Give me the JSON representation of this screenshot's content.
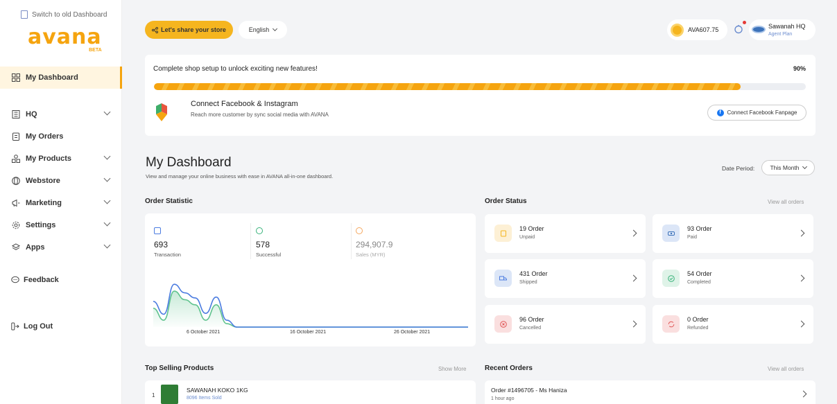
{
  "sidebar": {
    "switch_label": "Switch to old Dashboard",
    "logo": "avana",
    "logo_badge": "BETA",
    "items": [
      {
        "label": "My Dashboard",
        "icon": "grid-icon",
        "active": true
      },
      {
        "label": "HQ",
        "icon": "building-icon",
        "has_submenu": true
      },
      {
        "label": "My Orders",
        "icon": "clipboard-icon"
      },
      {
        "label": "My Products",
        "icon": "boxes-icon",
        "has_submenu": true
      },
      {
        "label": "Webstore",
        "icon": "globe-icon",
        "has_submenu": true
      },
      {
        "label": "Marketing",
        "icon": "megaphone-icon",
        "has_submenu": true
      },
      {
        "label": "Settings",
        "icon": "gear-icon",
        "has_submenu": true
      },
      {
        "label": "Apps",
        "icon": "layers-icon",
        "has_submenu": true
      }
    ],
    "feedback_label": "Feedback",
    "logout_label": "Log Out"
  },
  "topbar": {
    "share_label": "Let's share your store",
    "language": "English",
    "balance": "AVA607.75",
    "profile_name": "Sawanah HQ",
    "profile_plan": "Agent Plan"
  },
  "setup": {
    "title": "Complete shop setup to unlock exciting new features!",
    "percent_label": "90%",
    "progress": 0.9,
    "connect_title": "Connect Facebook & Instagram",
    "connect_sub": "Reach more customer by sync social media with AVANA",
    "connect_button": "Connect Facebook Fanpage"
  },
  "dashboard": {
    "title": "My Dashboard",
    "subtitle": "View and manage your online business with ease in AVANA all-in-one dashboard.",
    "period_label": "Date Period:",
    "period_value": "This Month"
  },
  "order_statistic": {
    "title": "Order Statistic",
    "stats": [
      {
        "value": "693",
        "label": "Transaction",
        "color": "#4a7be0"
      },
      {
        "value": "578",
        "label": "Successful",
        "color": "#38b27a"
      },
      {
        "value": "294,907.9",
        "label": "Sales (MYR)",
        "color": "#f5a75e"
      }
    ],
    "date_ticks": [
      "6 October 2021",
      "16 October 2021",
      "26 October 2021"
    ]
  },
  "order_status": {
    "title": "Order Status",
    "view_all": "View all orders",
    "items": [
      {
        "title": "19 Order",
        "sub": "Unpaid",
        "bg": "#fdf0d5",
        "fg": "#f5b51f"
      },
      {
        "title": "93 Order",
        "sub": "Paid",
        "bg": "#dce6f7",
        "fg": "#3c72b9"
      },
      {
        "title": "431 Order",
        "sub": "Shipped",
        "bg": "#dce6f7",
        "fg": "#4a7be0"
      },
      {
        "title": "54 Order",
        "sub": "Completed",
        "bg": "#dff3e8",
        "fg": "#38b27a"
      },
      {
        "title": "96 Order",
        "sub": "Cancelled",
        "bg": "#fadfdf",
        "fg": "#e05555"
      },
      {
        "title": "0 Order",
        "sub": "Refunded",
        "bg": "#fadfdf",
        "fg": "#e05555"
      }
    ]
  },
  "top_selling": {
    "title": "Top Selling Products",
    "show_more": "Show More",
    "items": [
      {
        "rank": "1",
        "name": "SAWANAH KOKO 1KG",
        "sold": "8096 Items Sold"
      }
    ]
  },
  "recent_orders": {
    "title": "Recent Orders",
    "view_all": "View all orders",
    "items": [
      {
        "title": "Order #1496705 - Ms Haniza",
        "time": "1 hour ago"
      }
    ]
  },
  "chart_data": {
    "type": "area",
    "x": [
      "1 Oct",
      "2 Oct",
      "3 Oct",
      "4 Oct",
      "5 Oct",
      "6 Oct",
      "7 Oct",
      "8 Oct",
      "9 Oct",
      "10 Oct",
      "11 Oct",
      "12 Oct",
      "13 Oct",
      "14 Oct",
      "15 Oct",
      "16 Oct",
      "17 Oct",
      "18 Oct",
      "19 Oct",
      "20 Oct",
      "21 Oct",
      "22 Oct",
      "23 Oct",
      "24 Oct",
      "25 Oct",
      "26 Oct",
      "27 Oct",
      "28 Oct",
      "29 Oct",
      "30 Oct",
      "31 Oct"
    ],
    "series": [
      {
        "color": "#4a7be0",
        "values": [
          30,
          15,
          50,
          40,
          34,
          16,
          35,
          8,
          0,
          0,
          0,
          0,
          0,
          0,
          0,
          0,
          0,
          0,
          0,
          0,
          0,
          0,
          0,
          0,
          0,
          0,
          0,
          0,
          0,
          0,
          0
        ]
      },
      {
        "color": "#5fc38e",
        "values": [
          22,
          8,
          42,
          32,
          26,
          8,
          26,
          4,
          0,
          0,
          0,
          0,
          0,
          0,
          0,
          0,
          0,
          0,
          0,
          0,
          0,
          0,
          0,
          0,
          0,
          0,
          0,
          0,
          0,
          0,
          0
        ]
      }
    ],
    "tick_labels": [
      "6 October 2021",
      "16 October 2021",
      "26 October 2021"
    ]
  }
}
